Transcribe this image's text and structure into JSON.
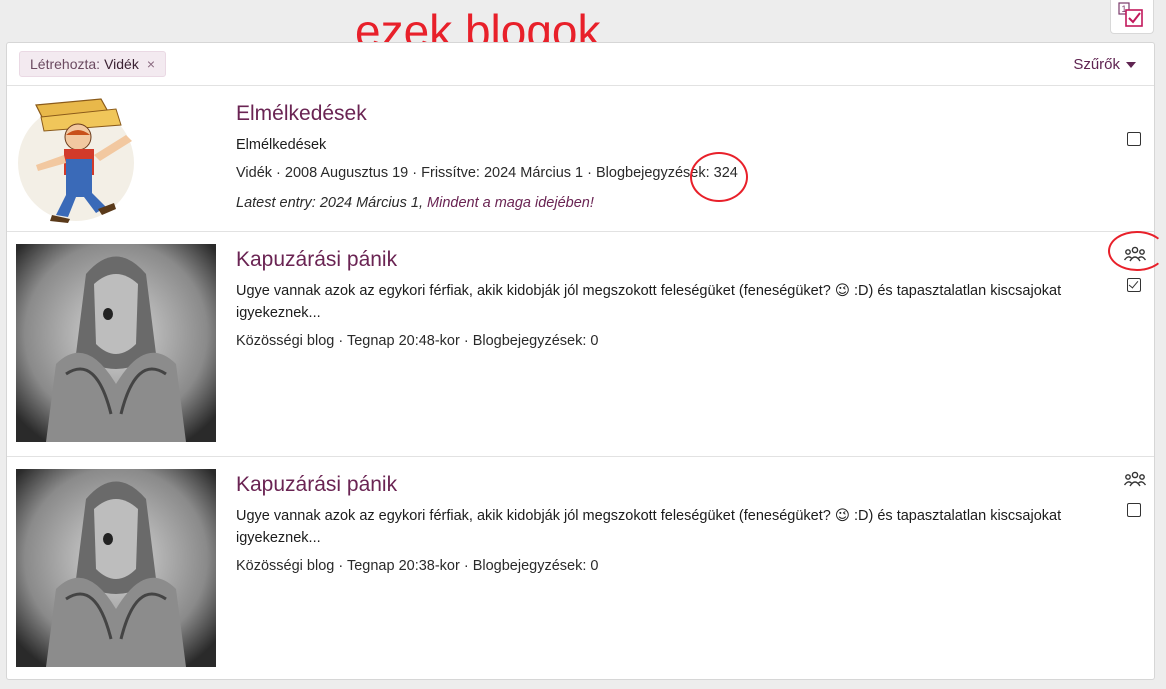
{
  "annotation": {
    "text": "ezek blogok",
    "color": "#e8202a"
  },
  "filter": {
    "label": "Létrehozta:",
    "value": "Vidék",
    "remove": "×"
  },
  "filters_button": {
    "label": "Szűrők"
  },
  "colors": {
    "accent": "#6a2453",
    "annotation": "#e8202a"
  },
  "blogs": [
    {
      "title": "Elmélkedések",
      "description": "Elmélkedések",
      "meta": "Vidék · 2008 Augusztus 19 · Frissítve: 2024 Március 1 · Blogbejegyzések: 324",
      "latest_prefix": "Latest entry: 2024 Március 1, ",
      "latest_link": "Mindent a maga idejében!",
      "checked": false,
      "thumb_icon": "cartoon-farmer-image"
    },
    {
      "title": "Kapuzárási pánik",
      "description": "Ugye vannak azok az egykori férfiak, akik kidobják jól megszokott feleségüket (feneségüket? 😉 :D) és tapasztalatlan kiscsajokat igyekeznek...",
      "meta": "Közösségi blog · Tegnap 20:48-kor · Blogbejegyzések: 0",
      "checked": true,
      "icon": "group-icon",
      "thumb_icon": "bw-person-photo"
    },
    {
      "title": "Kapuzárási pánik",
      "description": "Ugye vannak azok az egykori férfiak, akik kidobják jól megszokott feleségüket (feneségüket? 😉 :D) és tapasztalatlan kiscsajokat igyekeznek...",
      "meta": "Közösségi blog · Tegnap 20:38-kor · Blogbejegyzések: 0",
      "checked": false,
      "icon": "group-icon",
      "thumb_icon": "bw-person-photo"
    }
  ]
}
